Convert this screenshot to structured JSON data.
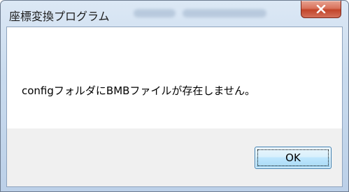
{
  "window": {
    "title": "座標変換プログラム",
    "close_icon": "close-icon"
  },
  "message": {
    "text": "configフォルダにBMBファイルが存在しません。"
  },
  "buttons": {
    "ok_label": "OK"
  },
  "colors": {
    "close_button": "#c2452a",
    "button_border": "#3c7fb1",
    "dialog_background": "#f0f0f0",
    "content_background": "#ffffff"
  }
}
